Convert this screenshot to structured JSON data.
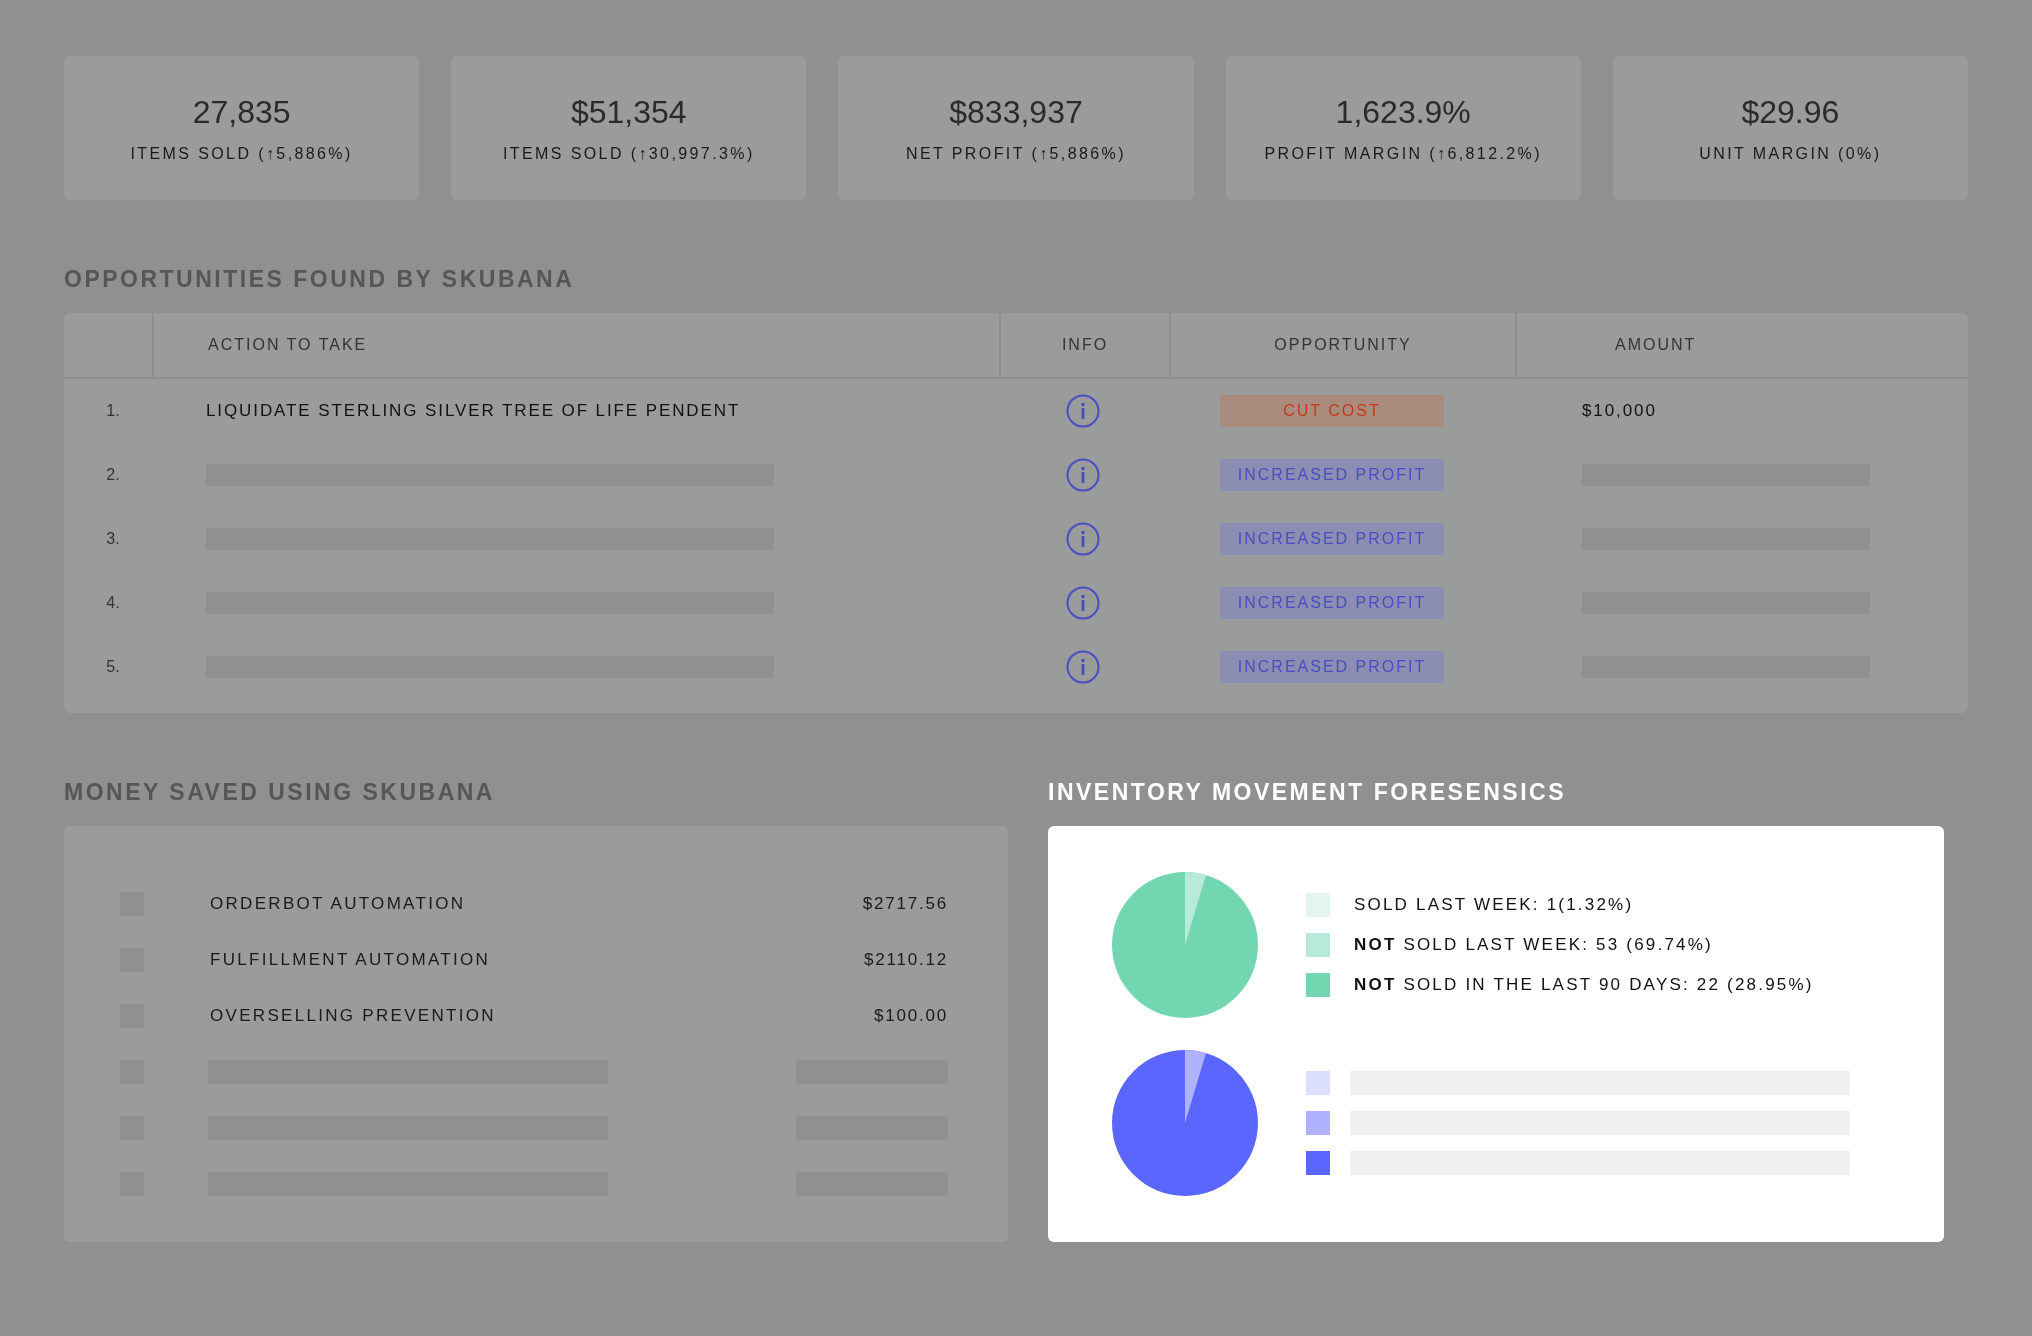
{
  "stats": [
    {
      "value": "27,835",
      "label": "ITEMS SOLD (↑5,886%)"
    },
    {
      "value": "$51,354",
      "label": "ITEMS SOLD (↑30,997.3%)"
    },
    {
      "value": "$833,937",
      "label": "NET PROFIT (↑5,886%)"
    },
    {
      "value": "1,623.9%",
      "label": "PROFIT MARGIN (↑6,812.2%)"
    },
    {
      "value": "$29.96",
      "label": "UNIT MARGIN (0%)"
    }
  ],
  "opportunities": {
    "title": "OPPORTUNITIES FOUND BY SKUBANA",
    "columns": [
      "ACTION TO TAKE",
      "INFO",
      "OPPORTUNITY",
      "AMOUNT"
    ],
    "rows": [
      {
        "number": "1.",
        "action": "LIQUIDATE STERLING SILVER TREE OF LIFE PENDENT",
        "badge": {
          "label": "CUT COST",
          "kind": "cut"
        },
        "amount": "$10,000"
      },
      {
        "number": "2.",
        "badge": {
          "label": "INCREASED PROFIT",
          "kind": "increase"
        }
      },
      {
        "number": "3.",
        "badge": {
          "label": "INCREASED PROFIT",
          "kind": "increase"
        }
      },
      {
        "number": "4.",
        "badge": {
          "label": "INCREASED PROFIT",
          "kind": "increase"
        }
      },
      {
        "number": "5.",
        "badge": {
          "label": "INCREASED PROFIT",
          "kind": "increase"
        }
      }
    ]
  },
  "money_saved": {
    "title": "MONEY SAVED USING SKUBANA",
    "items": [
      {
        "kind": "entry",
        "label": "ORDERBOT AUTOMATION",
        "amount": "$2717.56"
      },
      {
        "kind": "entry",
        "label": "FULFILLMENT AUTOMATION",
        "amount": "$2110.12"
      },
      {
        "kind": "entry",
        "label": "OVERSELLING PREVENTION",
        "amount": "$100.00"
      },
      {
        "kind": "placeholder"
      },
      {
        "kind": "placeholder"
      },
      {
        "kind": "placeholder"
      }
    ]
  },
  "inventory": {
    "title": "INVENTORY MOVEMENT FORESENSICS",
    "groups": [
      {
        "legend": [
          {
            "label": "SOLD LAST WEEK: 1(1.32%)",
            "color": "#e2f6ef"
          },
          {
            "label": "**NOT** SOLD LAST WEEK: 53 (69.74%)",
            "color": "#b8eadb"
          },
          {
            "label": "**NOT** SOLD IN THE LAST 90 DAYS: 22 (28.95%)",
            "color": "#72d6b0"
          }
        ]
      },
      {
        "legend": [
          {
            "color": "#dcdfff"
          },
          {
            "color": "#aeb2ff"
          },
          {
            "color": "#5b66ff"
          }
        ]
      }
    ]
  }
}
